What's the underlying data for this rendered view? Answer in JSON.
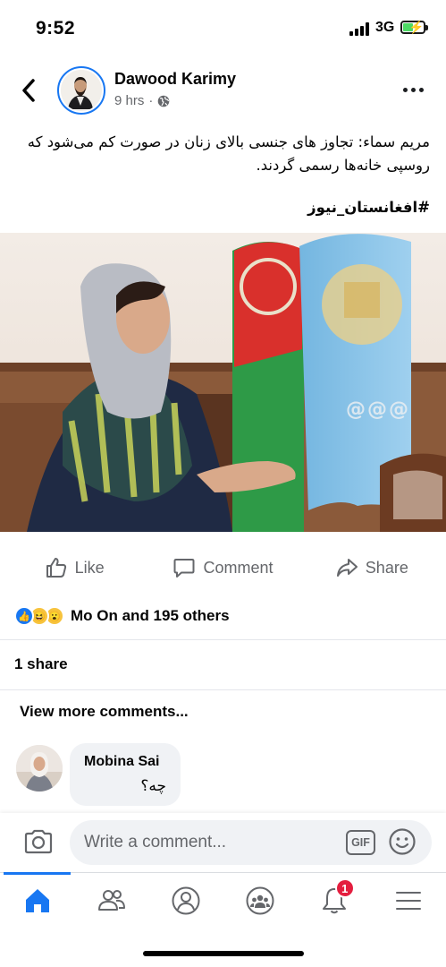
{
  "status_bar": {
    "time": "9:52",
    "network": "3G"
  },
  "post": {
    "author": "Dawood Karimy",
    "time": "9 hrs",
    "separator": "·",
    "text": "مریم سماء: تجاوز های جنسی بالای زنان در صورت کم می‌شود که روسپی خانه‌ها رسمی گردند.",
    "hashtag": "#افغانستان_نیوز",
    "photo_watermark": "@@@"
  },
  "actions": {
    "like": "Like",
    "comment": "Comment",
    "share": "Share"
  },
  "reactions": {
    "text": "Mo On and 195 others",
    "types": [
      "like-icon",
      "haha-icon",
      "wow-icon"
    ]
  },
  "shares": "1 share",
  "view_more_comments": "View more comments...",
  "comment": {
    "author": "Mobina Sai",
    "text": "چه؟"
  },
  "composer": {
    "placeholder": "Write a comment...",
    "gif_label": "GIF"
  },
  "tabbar": {
    "tabs": [
      "home-icon",
      "friends-icon",
      "profile-icon",
      "groups-icon",
      "notifications-icon",
      "menu-icon"
    ],
    "active": "home-icon",
    "notification_badge": "1"
  },
  "colors": {
    "accent": "#1877f2",
    "badge": "#e41e3f",
    "secondary_text": "#65676b"
  }
}
